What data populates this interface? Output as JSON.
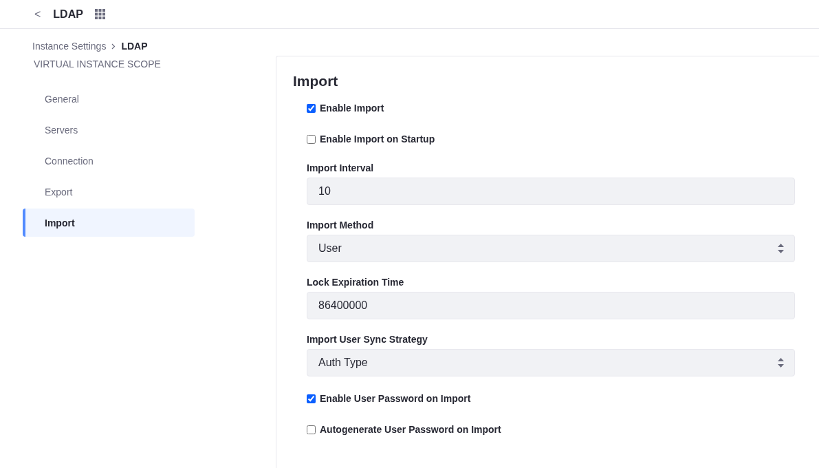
{
  "header": {
    "back": "<",
    "title": "LDAP"
  },
  "breadcrumb": [
    {
      "label": "Instance Settings"
    },
    {
      "label": "LDAP"
    }
  ],
  "sidebar": {
    "heading": "VIRTUAL INSTANCE SCOPE",
    "items": [
      {
        "label": "General",
        "selected": false
      },
      {
        "label": "Servers",
        "selected": false
      },
      {
        "label": "Connection",
        "selected": false
      },
      {
        "label": "Export",
        "selected": false
      },
      {
        "label": "Import",
        "selected": true
      }
    ]
  },
  "panel": {
    "title": "Import",
    "fields": [
      {
        "kind": "checkbox",
        "label": "Enable Import",
        "checked": true
      },
      {
        "kind": "checkbox",
        "label": "Enable Import on Startup",
        "checked": false
      },
      {
        "kind": "text",
        "label": "Import Interval",
        "value": "10"
      },
      {
        "kind": "select",
        "label": "Import Method",
        "value": "User"
      },
      {
        "kind": "text",
        "label": "Lock Expiration Time",
        "value": "86400000"
      },
      {
        "kind": "select",
        "label": "Import User Sync Strategy",
        "value": "Auth Type"
      },
      {
        "kind": "checkbox",
        "label": "Enable User Password on Import",
        "checked": true
      },
      {
        "kind": "checkbox",
        "label": "Autogenerate User Password on Import",
        "checked": false
      }
    ]
  }
}
